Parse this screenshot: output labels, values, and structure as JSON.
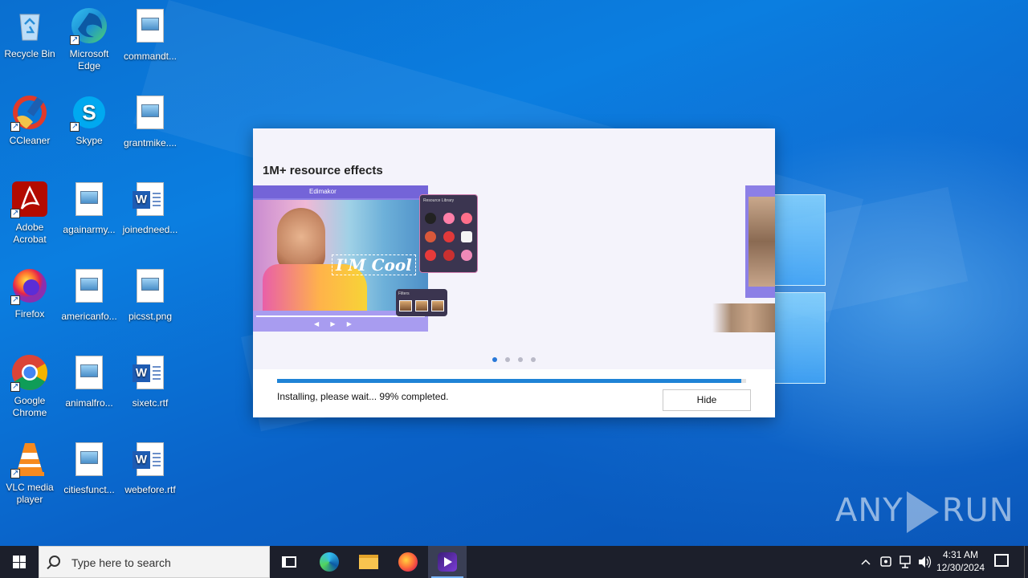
{
  "desktop": {
    "icons": [
      {
        "label": "Recycle Bin"
      },
      {
        "label": "Microsoft Edge"
      },
      {
        "label": "commandt..."
      },
      {
        "label": "CCleaner"
      },
      {
        "label": "Skype"
      },
      {
        "label": "grantmike...."
      },
      {
        "label": "Adobe Acrobat"
      },
      {
        "label": "againarmy..."
      },
      {
        "label": "joinedneed..."
      },
      {
        "label": "Firefox"
      },
      {
        "label": "americanfo..."
      },
      {
        "label": "picsst.png"
      },
      {
        "label": "Google Chrome"
      },
      {
        "label": "animalfro..."
      },
      {
        "label": "sixetc.rtf"
      },
      {
        "label": "VLC media player"
      },
      {
        "label": "citiesfunct..."
      },
      {
        "label": "webefore.rtf"
      }
    ]
  },
  "installer": {
    "headline": "1M+ resource effects",
    "preview_app_title": "Edimakor",
    "preview_overlay_text": "I'M Cool",
    "resource_panel_title": "Resource Library",
    "filter_title": "Filters",
    "carousel_dots": 4,
    "carousel_active": 0,
    "progress_percent": 99,
    "status_text": "Installing, please wait... 99% completed.",
    "hide_label": "Hide"
  },
  "watermark": {
    "text_left": "ANY",
    "text_right": "RUN"
  },
  "taskbar": {
    "search_placeholder": "Type here to search",
    "time": "4:31 AM",
    "date": "12/30/2024"
  },
  "colors": {
    "accent": "#1f83d6",
    "taskbar": "#1c1f2b",
    "installer_bg": "#f4f3fb"
  }
}
